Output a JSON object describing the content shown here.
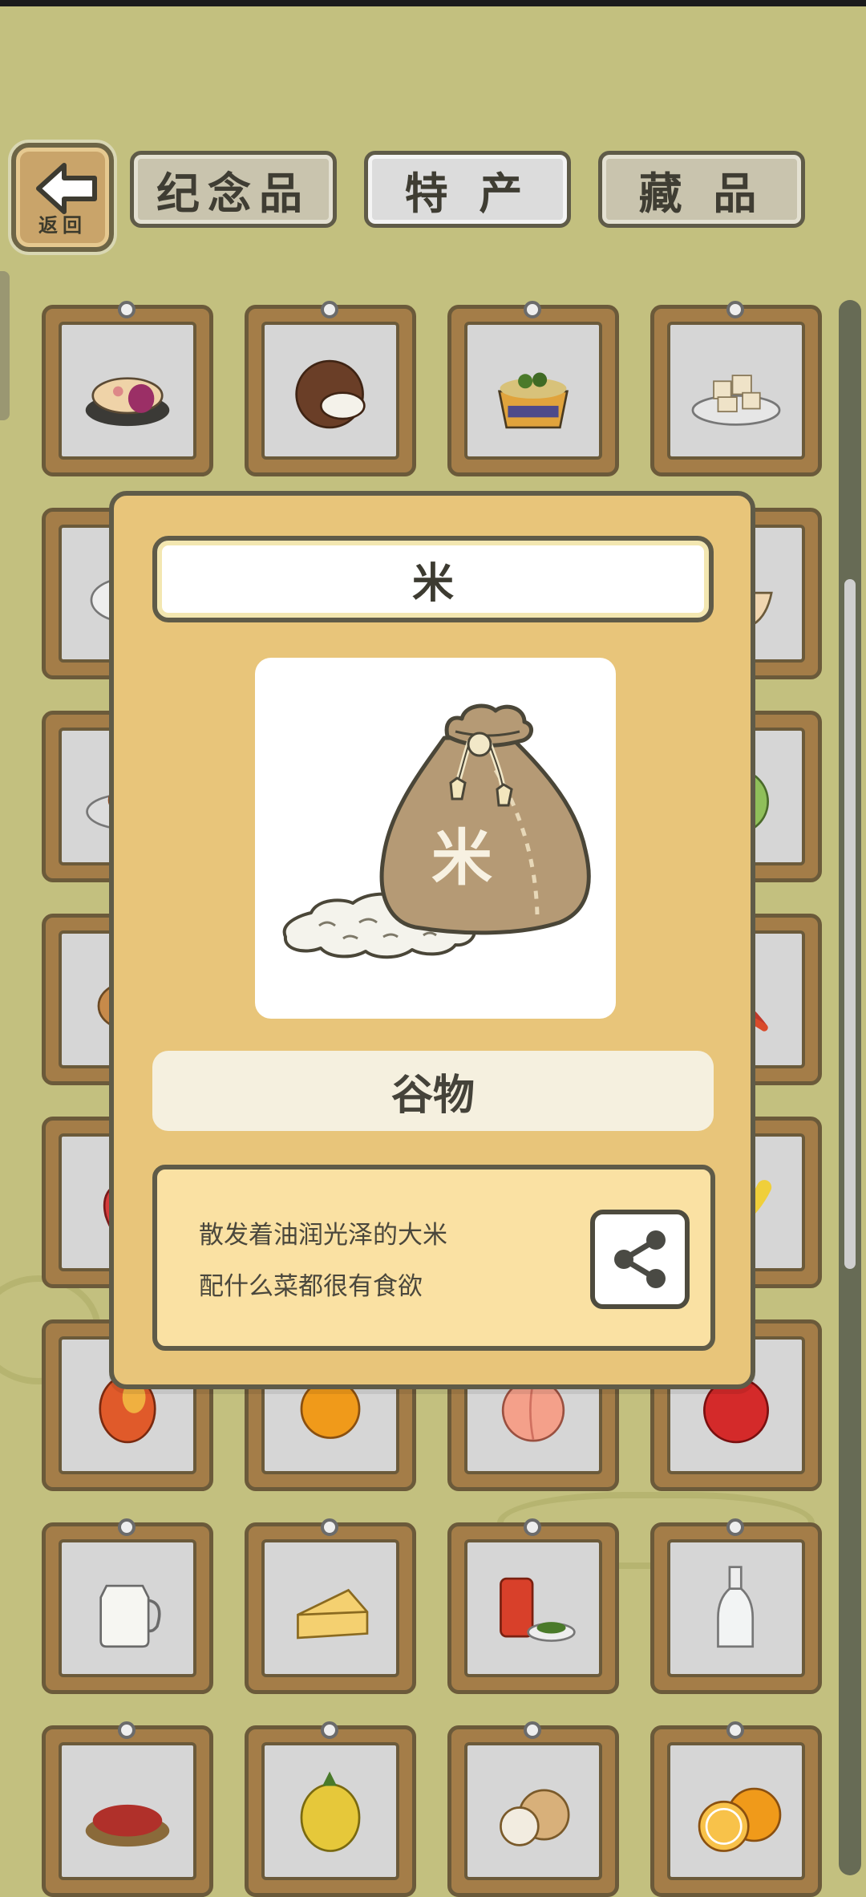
{
  "topbar": {
    "back_label": "返回",
    "tabs": [
      {
        "label": "纪念品",
        "active": false
      },
      {
        "label": "特 产",
        "active": true
      },
      {
        "label": "藏 品",
        "active": false
      }
    ]
  },
  "grid_items": [
    {
      "name": "mooncake"
    },
    {
      "name": "coconut"
    },
    {
      "name": "noodle-bowl"
    },
    {
      "name": "tofu-plate"
    },
    {
      "name": "dish"
    },
    {
      "name": "hidden"
    },
    {
      "name": "hidden"
    },
    {
      "name": "bowl"
    },
    {
      "name": "meat-dish"
    },
    {
      "name": "hidden"
    },
    {
      "name": "hidden"
    },
    {
      "name": "cabbage"
    },
    {
      "name": "potato"
    },
    {
      "name": "hidden"
    },
    {
      "name": "hidden"
    },
    {
      "name": "chili"
    },
    {
      "name": "strawberry"
    },
    {
      "name": "hidden"
    },
    {
      "name": "hidden"
    },
    {
      "name": "banana"
    },
    {
      "name": "mango"
    },
    {
      "name": "orange"
    },
    {
      "name": "peach"
    },
    {
      "name": "apple"
    },
    {
      "name": "milk-jug"
    },
    {
      "name": "cheese"
    },
    {
      "name": "tea-can"
    },
    {
      "name": "glass-bottle"
    },
    {
      "name": "goji-berries"
    },
    {
      "name": "horned-melon"
    },
    {
      "name": "longan"
    },
    {
      "name": "orange-halves"
    }
  ],
  "modal": {
    "title": "米",
    "image_icon": "rice-bag-icon",
    "bag_label": "米",
    "category": "谷物",
    "description": [
      "散发着油润光泽的大米",
      "配什么菜都很有食欲"
    ],
    "share_icon": "share-icon"
  },
  "colors": {
    "background": "#c3c07f",
    "modal": "#e8c57a",
    "frame_wood": "#a47d48"
  }
}
